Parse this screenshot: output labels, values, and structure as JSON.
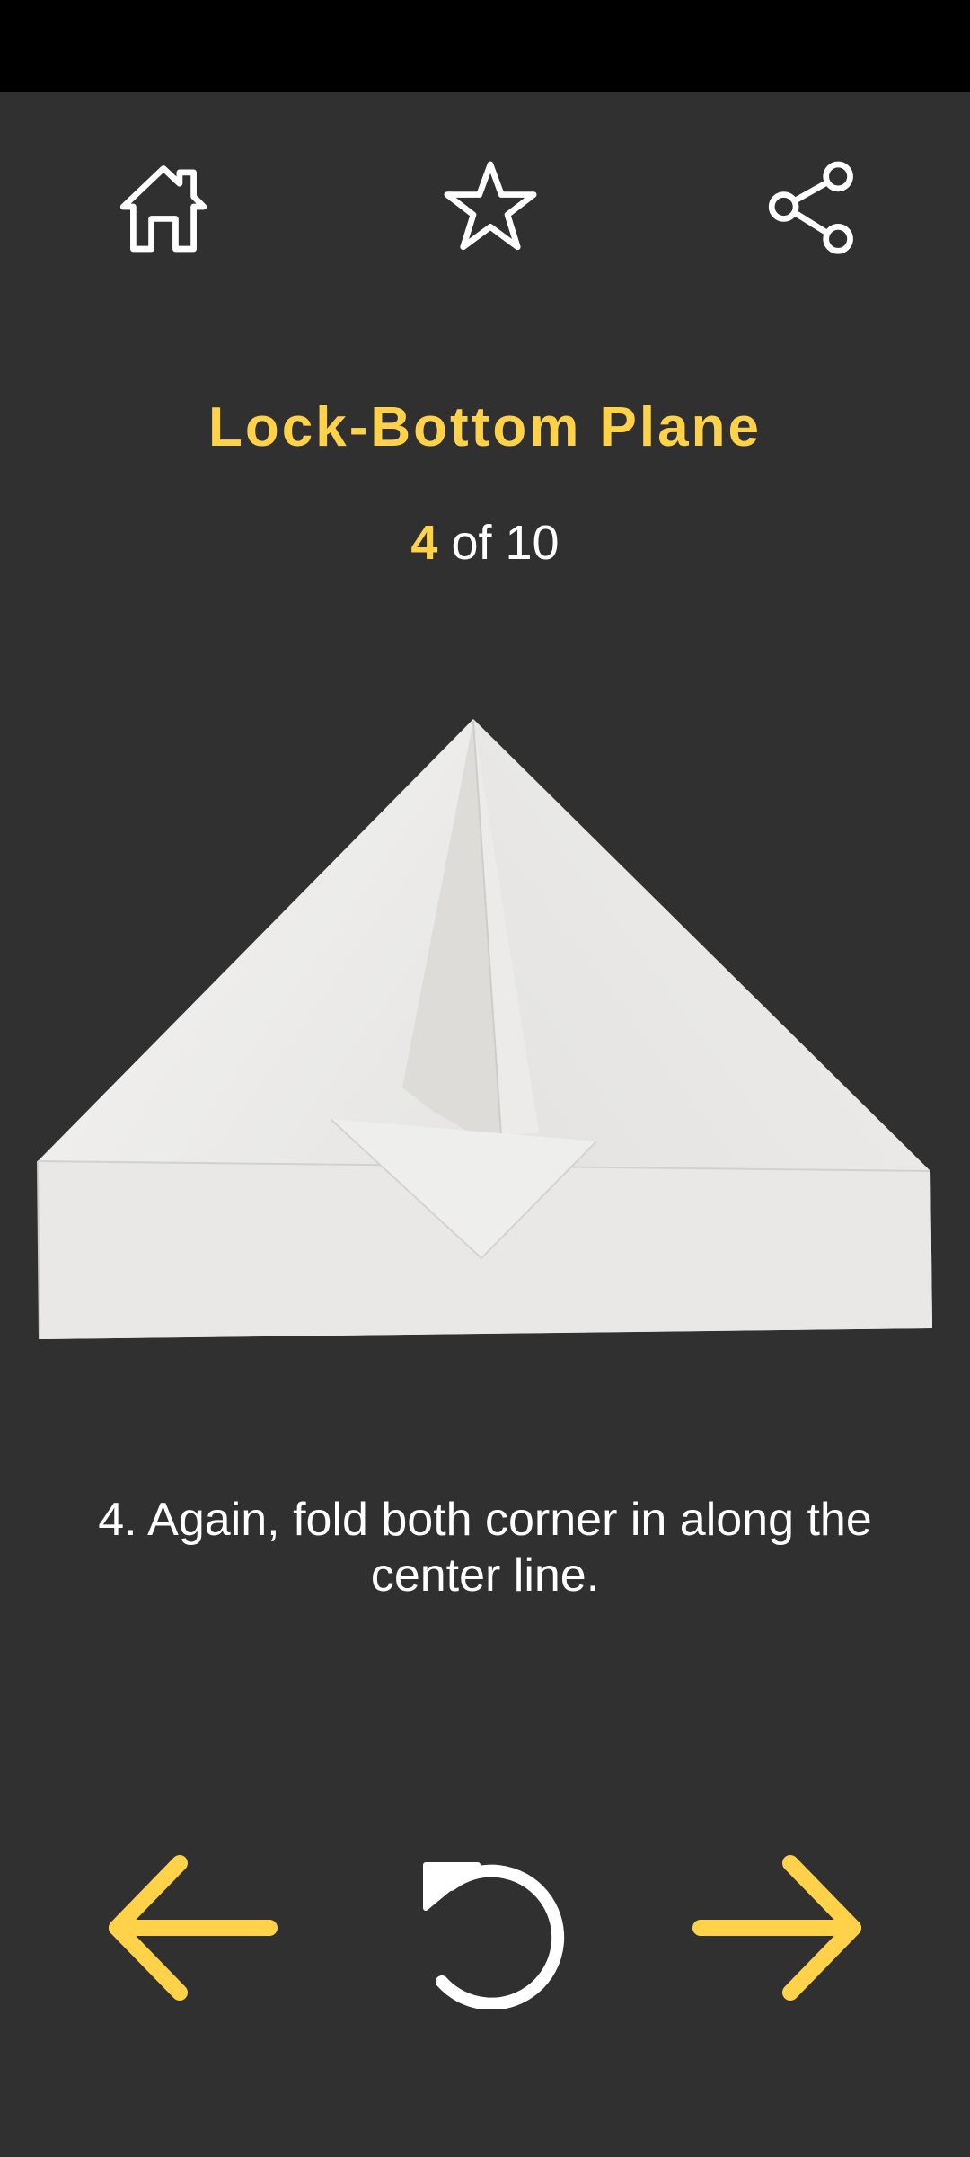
{
  "icons": {
    "home": "home-icon",
    "favorite": "star-icon",
    "share": "share-icon",
    "previous": "arrow-left-icon",
    "replay": "replay-icon",
    "next": "arrow-right-icon"
  },
  "colors": {
    "accent": "#FFD24A",
    "background": "#303030",
    "status_bar": "#000000",
    "icon_white": "#FFFFFF"
  },
  "header": {
    "title": "Lock-Bottom Plane"
  },
  "progress": {
    "current": "4",
    "of_text": " of 10"
  },
  "step": {
    "instruction": "4.  Again, fold both corner in along the center line."
  }
}
